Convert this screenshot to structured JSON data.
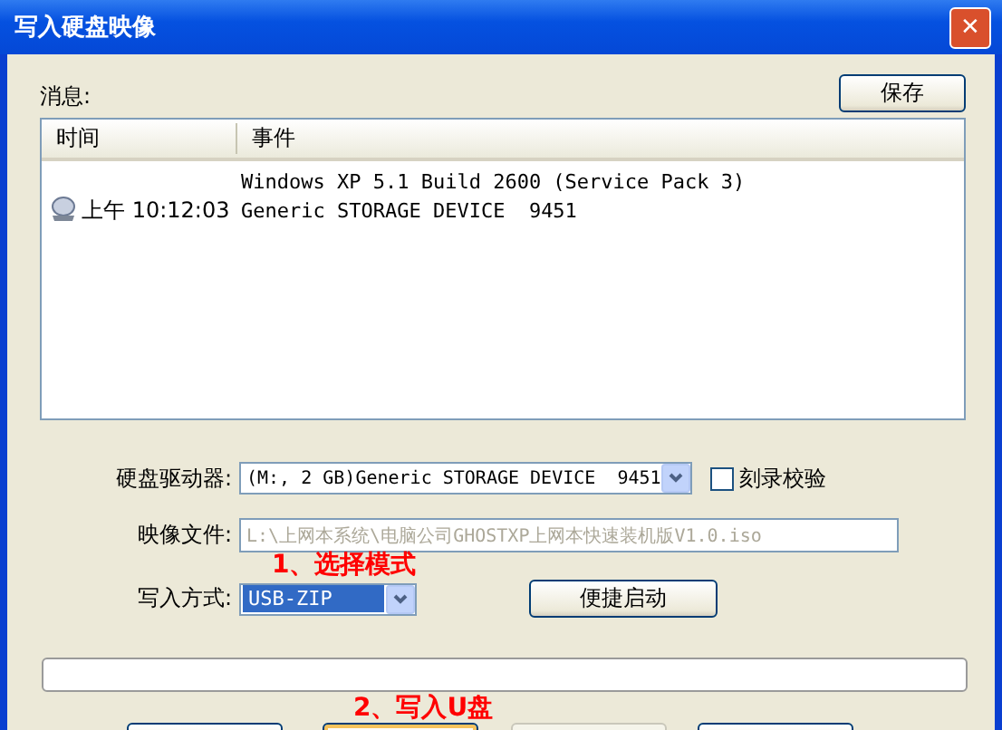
{
  "window": {
    "title": "写入硬盘映像",
    "close": "✕"
  },
  "messages": {
    "label": "消息:",
    "save_button": "保存",
    "columns": [
      "时间",
      "事件"
    ],
    "rows": [
      {
        "kind": "text",
        "event": "Windows XP 5.1 Build 2600 (Service Pack 3)"
      },
      {
        "kind": "device",
        "time": "上午 10:12:03",
        "event": "Generic STORAGE DEVICE  9451"
      }
    ]
  },
  "drive": {
    "label": "硬盘驱动器:",
    "value": "(M:, 2 GB)Generic STORAGE DEVICE  9451"
  },
  "verify": {
    "label": "刻录校验",
    "checked": false
  },
  "image_file": {
    "label": "映像文件:",
    "value": "L:\\上网本系统\\电脑公司GHOSTXP上网本快速装机版V1.0.iso",
    "disabled": true
  },
  "annotation_1": "1、选择模式",
  "write_mode": {
    "label": "写入方式:",
    "value": "USB-ZIP",
    "selected": true
  },
  "quick_boot_button": "便捷启动",
  "progress": {
    "level": 0
  },
  "annotation_2": "2、写入U盘",
  "bottom_buttons": [
    {
      "default": false,
      "disabled": false
    },
    {
      "default": true,
      "disabled": false
    },
    {
      "default": false,
      "disabled": true
    },
    {
      "default": false,
      "disabled": false
    }
  ]
}
